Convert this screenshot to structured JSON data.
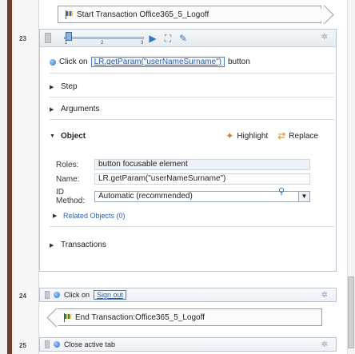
{
  "line_numbers": {
    "step_23": "23",
    "step_24": "24",
    "step_25": "25"
  },
  "start_transaction": {
    "label": "Start Transaction Office365_5_Logoff"
  },
  "end_transaction": {
    "label": "End Transaction:Office365_5_Logoff"
  },
  "step": {
    "slider_ticks": [
      "1",
      "2",
      "3"
    ],
    "click_prefix": "Click on",
    "click_target": "LR.getParam(\"userNameSurname\")",
    "click_suffix": "button",
    "sections": {
      "step": "Step",
      "arguments": "Arguments",
      "object": "Object",
      "transactions": "Transactions"
    },
    "actions": {
      "highlight": "Highlight",
      "replace": "Replace"
    },
    "object": {
      "roles_label": "Roles:",
      "roles_value": "button focusable element",
      "name_label": "Name:",
      "name_value": "LR.getParam(\"userNameSurname\")",
      "id_method_label": "ID Method:",
      "id_method_value": "Automatic (recommended)"
    },
    "related_objects": "Related Objects (0)"
  },
  "step_24": {
    "prefix": "Click on",
    "target": "Sign out"
  },
  "step_25": {
    "label": "Close active tab"
  },
  "colors": {
    "accent": "#2a5faf",
    "left_bar": "#6e3d2c"
  }
}
